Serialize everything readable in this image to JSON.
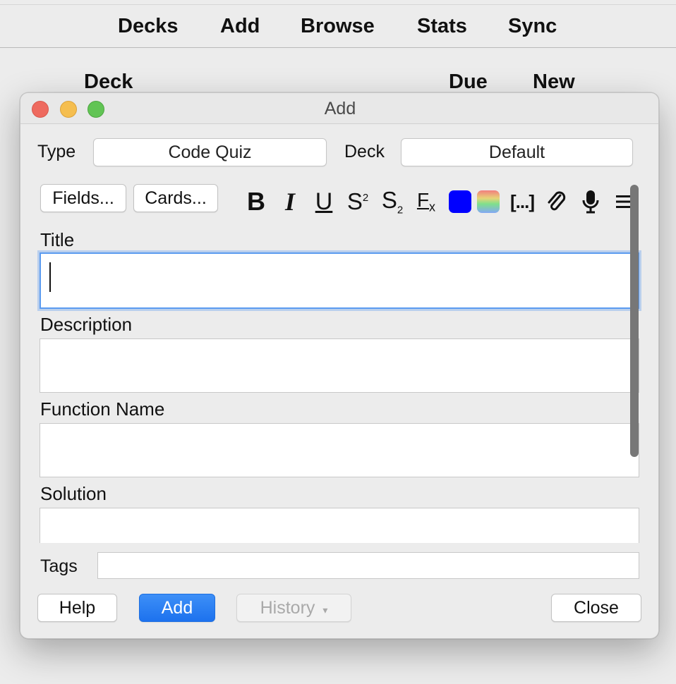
{
  "main_window": {
    "toolbar": [
      "Decks",
      "Add",
      "Browse",
      "Stats",
      "Sync"
    ],
    "columns": {
      "deck": "Deck",
      "due": "Due",
      "new": "New"
    }
  },
  "dialog": {
    "title": "Add",
    "type_label": "Type",
    "type_value": "Code Quiz",
    "deck_label": "Deck",
    "deck_value": "Default",
    "fields_button": "Fields...",
    "cards_button": "Cards...",
    "toolbar_icons": [
      {
        "name": "bold-icon",
        "glyph": "B"
      },
      {
        "name": "italic-icon",
        "glyph": "I"
      },
      {
        "name": "underline-icon",
        "glyph": "U"
      },
      {
        "name": "superscript-icon",
        "glyph": "S²"
      },
      {
        "name": "subscript-icon",
        "glyph": "S₂"
      },
      {
        "name": "clear-format-icon",
        "glyph": "Fx"
      },
      {
        "name": "text-color-icon",
        "color": "#0000ff"
      },
      {
        "name": "highlight-color-icon"
      },
      {
        "name": "cloze-icon",
        "glyph": "[...]"
      },
      {
        "name": "attach-icon"
      },
      {
        "name": "record-audio-icon"
      },
      {
        "name": "menu-icon",
        "glyph": "≡"
      }
    ],
    "fields": [
      {
        "label": "Title",
        "value": ""
      },
      {
        "label": "Description",
        "value": ""
      },
      {
        "label": "Function Name",
        "value": ""
      },
      {
        "label": "Solution",
        "value": ""
      }
    ],
    "tags_label": "Tags",
    "tags_value": "",
    "buttons": {
      "help": "Help",
      "add": "Add",
      "history": "History",
      "history_arrow": "▾",
      "close": "Close"
    }
  },
  "colors": {
    "accent": "#1d72ee",
    "focus_ring": "#5b9bf0",
    "text_color_swatch": "#0000ff"
  }
}
